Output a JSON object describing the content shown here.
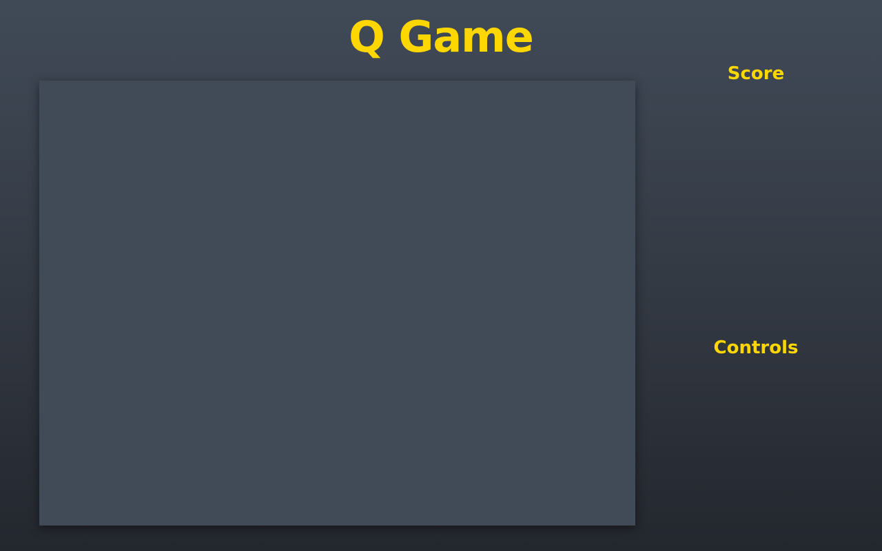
{
  "header": {
    "title": "Q Game"
  },
  "sidebar": {
    "score_heading": "Score",
    "controls_heading": "Controls"
  },
  "colors": {
    "accent": "#ffd700",
    "board": "#404b57"
  }
}
